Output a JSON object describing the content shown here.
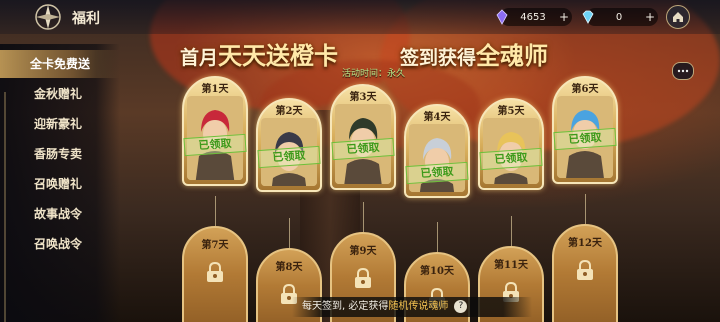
{
  "header": {
    "title": "福利",
    "resources": [
      {
        "icon": "soul-crystal-icon",
        "value": "4653"
      },
      {
        "icon": "diamond-icon",
        "value": "0"
      }
    ],
    "plus_label": "+"
  },
  "menu": {
    "items": [
      {
        "label": "全卡免费送",
        "active": true
      },
      {
        "label": "金秋赠礼",
        "active": false
      },
      {
        "label": "迎新豪礼",
        "active": false
      },
      {
        "label": "香肠专卖",
        "active": false
      },
      {
        "label": "召唤赠礼",
        "active": false
      },
      {
        "label": "故事战令",
        "active": false
      },
      {
        "label": "召唤战令",
        "active": false
      }
    ]
  },
  "event": {
    "headline_part1_small": "首月",
    "headline_part1_big": "天天送橙卡",
    "headline_part2_small": "签到获得",
    "headline_part2_big": "全魂师",
    "subtitle": "活动时间：永久"
  },
  "claimed_stamp": "已领取",
  "claimed_days": [
    {
      "label": "第1天"
    },
    {
      "label": "第2天"
    },
    {
      "label": "第3天"
    },
    {
      "label": "第4天"
    },
    {
      "label": "第5天"
    },
    {
      "label": "第6天"
    }
  ],
  "locked_days": [
    {
      "label": "第7天"
    },
    {
      "label": "第8天"
    },
    {
      "label": "第9天"
    },
    {
      "label": "第10天"
    },
    {
      "label": "第11天"
    },
    {
      "label": "第12天"
    }
  ],
  "footer": {
    "text_before": "每天签到, 必定获得",
    "text_highlight": "随机传说魂师",
    "help_label": "?"
  },
  "colors": {
    "claimed_stamp": "#3d9a1a",
    "highlight": "#f7c552",
    "card_gold": "#d8ae5b"
  }
}
